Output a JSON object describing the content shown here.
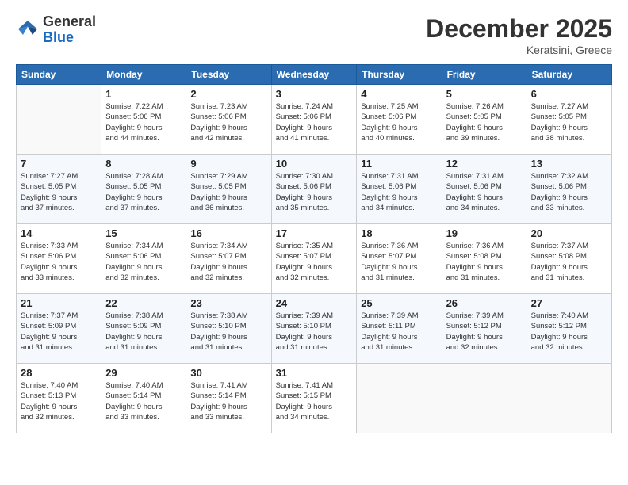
{
  "header": {
    "logo_line1": "General",
    "logo_line2": "Blue",
    "month": "December 2025",
    "location": "Keratsini, Greece"
  },
  "weekdays": [
    "Sunday",
    "Monday",
    "Tuesday",
    "Wednesday",
    "Thursday",
    "Friday",
    "Saturday"
  ],
  "weeks": [
    [
      {
        "day": "",
        "info": ""
      },
      {
        "day": "1",
        "info": "Sunrise: 7:22 AM\nSunset: 5:06 PM\nDaylight: 9 hours\nand 44 minutes."
      },
      {
        "day": "2",
        "info": "Sunrise: 7:23 AM\nSunset: 5:06 PM\nDaylight: 9 hours\nand 42 minutes."
      },
      {
        "day": "3",
        "info": "Sunrise: 7:24 AM\nSunset: 5:06 PM\nDaylight: 9 hours\nand 41 minutes."
      },
      {
        "day": "4",
        "info": "Sunrise: 7:25 AM\nSunset: 5:06 PM\nDaylight: 9 hours\nand 40 minutes."
      },
      {
        "day": "5",
        "info": "Sunrise: 7:26 AM\nSunset: 5:05 PM\nDaylight: 9 hours\nand 39 minutes."
      },
      {
        "day": "6",
        "info": "Sunrise: 7:27 AM\nSunset: 5:05 PM\nDaylight: 9 hours\nand 38 minutes."
      }
    ],
    [
      {
        "day": "7",
        "info": "Sunrise: 7:27 AM\nSunset: 5:05 PM\nDaylight: 9 hours\nand 37 minutes."
      },
      {
        "day": "8",
        "info": "Sunrise: 7:28 AM\nSunset: 5:05 PM\nDaylight: 9 hours\nand 37 minutes."
      },
      {
        "day": "9",
        "info": "Sunrise: 7:29 AM\nSunset: 5:05 PM\nDaylight: 9 hours\nand 36 minutes."
      },
      {
        "day": "10",
        "info": "Sunrise: 7:30 AM\nSunset: 5:06 PM\nDaylight: 9 hours\nand 35 minutes."
      },
      {
        "day": "11",
        "info": "Sunrise: 7:31 AM\nSunset: 5:06 PM\nDaylight: 9 hours\nand 34 minutes."
      },
      {
        "day": "12",
        "info": "Sunrise: 7:31 AM\nSunset: 5:06 PM\nDaylight: 9 hours\nand 34 minutes."
      },
      {
        "day": "13",
        "info": "Sunrise: 7:32 AM\nSunset: 5:06 PM\nDaylight: 9 hours\nand 33 minutes."
      }
    ],
    [
      {
        "day": "14",
        "info": "Sunrise: 7:33 AM\nSunset: 5:06 PM\nDaylight: 9 hours\nand 33 minutes."
      },
      {
        "day": "15",
        "info": "Sunrise: 7:34 AM\nSunset: 5:06 PM\nDaylight: 9 hours\nand 32 minutes."
      },
      {
        "day": "16",
        "info": "Sunrise: 7:34 AM\nSunset: 5:07 PM\nDaylight: 9 hours\nand 32 minutes."
      },
      {
        "day": "17",
        "info": "Sunrise: 7:35 AM\nSunset: 5:07 PM\nDaylight: 9 hours\nand 32 minutes."
      },
      {
        "day": "18",
        "info": "Sunrise: 7:36 AM\nSunset: 5:07 PM\nDaylight: 9 hours\nand 31 minutes."
      },
      {
        "day": "19",
        "info": "Sunrise: 7:36 AM\nSunset: 5:08 PM\nDaylight: 9 hours\nand 31 minutes."
      },
      {
        "day": "20",
        "info": "Sunrise: 7:37 AM\nSunset: 5:08 PM\nDaylight: 9 hours\nand 31 minutes."
      }
    ],
    [
      {
        "day": "21",
        "info": "Sunrise: 7:37 AM\nSunset: 5:09 PM\nDaylight: 9 hours\nand 31 minutes."
      },
      {
        "day": "22",
        "info": "Sunrise: 7:38 AM\nSunset: 5:09 PM\nDaylight: 9 hours\nand 31 minutes."
      },
      {
        "day": "23",
        "info": "Sunrise: 7:38 AM\nSunset: 5:10 PM\nDaylight: 9 hours\nand 31 minutes."
      },
      {
        "day": "24",
        "info": "Sunrise: 7:39 AM\nSunset: 5:10 PM\nDaylight: 9 hours\nand 31 minutes."
      },
      {
        "day": "25",
        "info": "Sunrise: 7:39 AM\nSunset: 5:11 PM\nDaylight: 9 hours\nand 31 minutes."
      },
      {
        "day": "26",
        "info": "Sunrise: 7:39 AM\nSunset: 5:12 PM\nDaylight: 9 hours\nand 32 minutes."
      },
      {
        "day": "27",
        "info": "Sunrise: 7:40 AM\nSunset: 5:12 PM\nDaylight: 9 hours\nand 32 minutes."
      }
    ],
    [
      {
        "day": "28",
        "info": "Sunrise: 7:40 AM\nSunset: 5:13 PM\nDaylight: 9 hours\nand 32 minutes."
      },
      {
        "day": "29",
        "info": "Sunrise: 7:40 AM\nSunset: 5:14 PM\nDaylight: 9 hours\nand 33 minutes."
      },
      {
        "day": "30",
        "info": "Sunrise: 7:41 AM\nSunset: 5:14 PM\nDaylight: 9 hours\nand 33 minutes."
      },
      {
        "day": "31",
        "info": "Sunrise: 7:41 AM\nSunset: 5:15 PM\nDaylight: 9 hours\nand 34 minutes."
      },
      {
        "day": "",
        "info": ""
      },
      {
        "day": "",
        "info": ""
      },
      {
        "day": "",
        "info": ""
      }
    ]
  ]
}
